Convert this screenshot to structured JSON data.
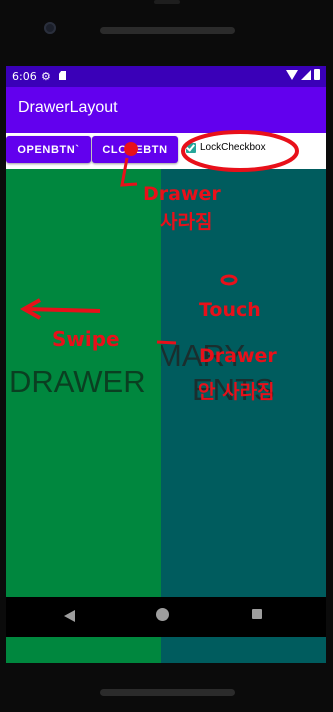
{
  "status_bar": {
    "time": "6:06"
  },
  "app_bar": {
    "title": "DrawerLayout"
  },
  "buttons": {
    "open_label": "OPENBTN`",
    "close_label": "CLOSEBTN"
  },
  "checkbox": {
    "label": "LockCheckbox",
    "checked": true
  },
  "content": {
    "drawer_text": "DRAWER",
    "main_text_line1": "MARY",
    "main_text_line2": "ENTS"
  },
  "annotations": {
    "drawer_disappear_line1": "Drawer",
    "drawer_disappear_line2": "사라짐",
    "swipe": "Swipe",
    "touch": "Touch",
    "drawer_stays_line1": "Drawer",
    "drawer_stays_line2": "안 사라짐"
  },
  "colors": {
    "status_bar": "#3a00b8",
    "app_bar": "#6200ee",
    "button": "#6200ee",
    "checkbox": "#26a69a",
    "drawer": "#00873e",
    "main": "#005c5e",
    "annotation": "#e8101a"
  }
}
